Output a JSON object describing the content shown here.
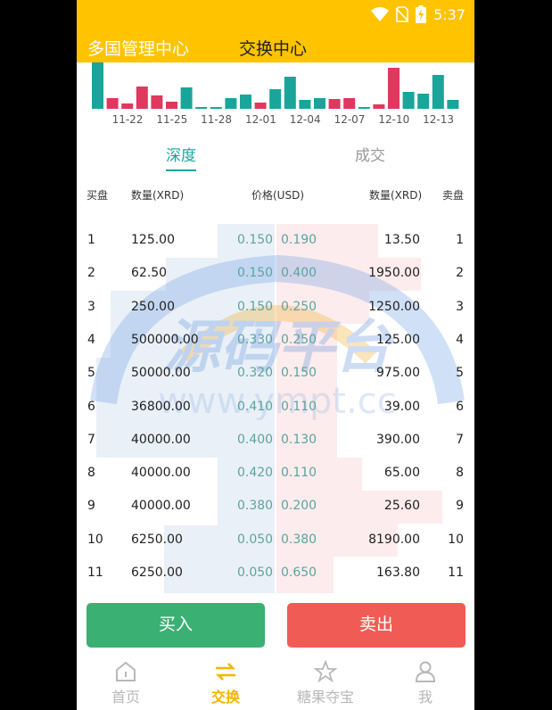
{
  "status_bar": {
    "time": "5:37"
  },
  "header": {
    "left_link": "多国管理中心",
    "title": "交换中心"
  },
  "colors": {
    "accent": "#ffc300",
    "teal": "#1aa59a",
    "buy": "#3bb073",
    "sell": "#f15b55"
  },
  "chart_data": {
    "type": "bar",
    "x_tick_labels": [
      "11-22",
      "11-25",
      "11-28",
      "12-01",
      "12-04",
      "12-07",
      "12-10",
      "12-13"
    ],
    "values": [
      52,
      12,
      6,
      25,
      15,
      8,
      24,
      2,
      2,
      12,
      16,
      7,
      22,
      36,
      10,
      12,
      11,
      12,
      2,
      5,
      46,
      19,
      17,
      38,
      10
    ],
    "colors": [
      "teal",
      "red",
      "red",
      "red",
      "red",
      "red",
      "teal",
      "teal",
      "teal",
      "teal",
      "teal",
      "red",
      "teal",
      "teal",
      "teal",
      "teal",
      "red",
      "red",
      "teal",
      "red",
      "red",
      "teal",
      "teal",
      "teal",
      "teal"
    ],
    "grid": false
  },
  "tabs": [
    {
      "label": "深度"
    },
    {
      "label": "成交"
    }
  ],
  "table": {
    "headers": {
      "buy": "买盘",
      "buy_qty": "数量(XRD)",
      "price": "价格(USD)",
      "sell_qty": "数量(XRD)",
      "sell": "卖盘"
    },
    "rows": [
      {
        "idx": "1",
        "bid_qty": "125.00",
        "bid_price": "0.150",
        "ask_price": "0.190",
        "ask_qty": "13.50",
        "ask_idx": "1"
      },
      {
        "idx": "2",
        "bid_qty": "62.50",
        "bid_price": "0.150",
        "ask_price": "0.400",
        "ask_qty": "1950.00",
        "ask_idx": "2"
      },
      {
        "idx": "3",
        "bid_qty": "250.00",
        "bid_price": "0.150",
        "ask_price": "0.250",
        "ask_qty": "1250.00",
        "ask_idx": "3"
      },
      {
        "idx": "4",
        "bid_qty": "500000.00",
        "bid_price": "0.330",
        "ask_price": "0.250",
        "ask_qty": "125.00",
        "ask_idx": "4"
      },
      {
        "idx": "5",
        "bid_qty": "50000.00",
        "bid_price": "0.320",
        "ask_price": "0.150",
        "ask_qty": "975.00",
        "ask_idx": "5"
      },
      {
        "idx": "6",
        "bid_qty": "36800.00",
        "bid_price": "0.410",
        "ask_price": "0.110",
        "ask_qty": "39.00",
        "ask_idx": "6"
      },
      {
        "idx": "7",
        "bid_qty": "40000.00",
        "bid_price": "0.400",
        "ask_price": "0.130",
        "ask_qty": "390.00",
        "ask_idx": "7"
      },
      {
        "idx": "8",
        "bid_qty": "40000.00",
        "bid_price": "0.420",
        "ask_price": "0.110",
        "ask_qty": "65.00",
        "ask_idx": "8"
      },
      {
        "idx": "9",
        "bid_qty": "40000.00",
        "bid_price": "0.380",
        "ask_price": "0.200",
        "ask_qty": "25.60",
        "ask_idx": "9"
      },
      {
        "idx": "10",
        "bid_qty": "6250.00",
        "bid_price": "0.050",
        "ask_price": "0.380",
        "ask_qty": "8190.00",
        "ask_idx": "10"
      },
      {
        "idx": "11",
        "bid_qty": "6250.00",
        "bid_price": "0.050",
        "ask_price": "0.650",
        "ask_qty": "163.80",
        "ask_idx": "11"
      }
    ]
  },
  "watermark": {
    "title": "源码平台",
    "url": "www.ympt.cc"
  },
  "buttons": {
    "buy": "买入",
    "sell": "卖出"
  },
  "bottom_nav": [
    {
      "label": "首页",
      "icon": "home-icon"
    },
    {
      "label": "交换",
      "icon": "exchange-icon",
      "active": true
    },
    {
      "label": "糖果夺宝",
      "icon": "star-icon"
    },
    {
      "label": "我",
      "icon": "user-icon"
    }
  ]
}
